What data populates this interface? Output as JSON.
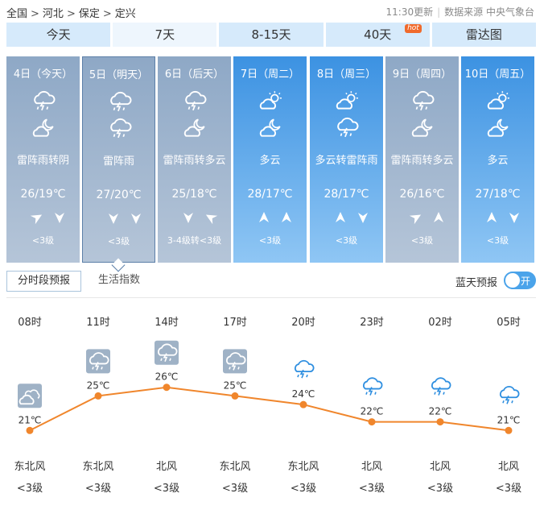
{
  "breadcrumb": {
    "items": [
      "全国",
      "河北",
      "保定",
      "定兴"
    ],
    "separator": ">"
  },
  "meta": {
    "updated": "11:30更新",
    "source": "数据来源 中央气象台"
  },
  "tabs": [
    {
      "label": "今天",
      "active": false
    },
    {
      "label": "7天",
      "active": true
    },
    {
      "label": "8-15天",
      "active": false
    },
    {
      "label": "40天",
      "active": false,
      "badge": "hot"
    },
    {
      "label": "雷达图",
      "active": false
    }
  ],
  "days": [
    {
      "date": "4日（今天）",
      "condition": "雷阵雨转阴",
      "temp": "26/19℃",
      "wind": "<3级",
      "icon1": "thunder-rain-icon",
      "icon2": "cloudy-night-icon",
      "dir1": "ne",
      "dir2": "s",
      "style": "past"
    },
    {
      "date": "5日（明天）",
      "condition": "雷阵雨",
      "temp": "27/20℃",
      "wind": "<3级",
      "icon1": "thunder-rain-icon",
      "icon2": "thunder-rain-icon",
      "dir1": "s",
      "dir2": "s",
      "style": "past",
      "selected": true
    },
    {
      "date": "6日（后天）",
      "condition": "雷阵雨转多云",
      "temp": "25/18℃",
      "wind": "3-4级转<3级",
      "icon1": "thunder-rain-icon",
      "icon2": "partly-cloudy-night-icon",
      "dir1": "s",
      "dir2": "nw",
      "style": "past"
    },
    {
      "date": "7日（周二）",
      "condition": "多云",
      "temp": "28/17℃",
      "wind": "<3级",
      "icon1": "partly-cloudy-day-icon",
      "icon2": "partly-cloudy-night-icon",
      "dir1": "n",
      "dir2": "n",
      "style": "fut"
    },
    {
      "date": "8日（周三）",
      "condition": "多云转雷阵雨",
      "temp": "28/17℃",
      "wind": "<3级",
      "icon1": "partly-cloudy-day-icon",
      "icon2": "thunder-rain-icon",
      "dir1": "n",
      "dir2": "s",
      "style": "fut"
    },
    {
      "date": "9日（周四）",
      "condition": "雷阵雨转多云",
      "temp": "26/16℃",
      "wind": "<3级",
      "icon1": "thunder-rain-icon",
      "icon2": "partly-cloudy-night-icon",
      "dir1": "ne",
      "dir2": "n",
      "style": "past"
    },
    {
      "date": "10日（周五）",
      "condition": "多云",
      "temp": "27/18℃",
      "wind": "<3级",
      "icon1": "partly-cloudy-day-icon",
      "icon2": "partly-cloudy-night-icon",
      "dir1": "n",
      "dir2": "s",
      "style": "fut"
    }
  ],
  "subtabs": {
    "active": "分时段预报",
    "other": "生活指数"
  },
  "bluesky": {
    "label": "蓝天预报",
    "toggle_label": "开"
  },
  "hourly": {
    "times": [
      "08时",
      "11时",
      "14时",
      "17时",
      "20时",
      "23时",
      "02时",
      "05时"
    ],
    "temps_label": [
      "21℃",
      "25℃",
      "26℃",
      "25℃",
      "24℃",
      "22℃",
      "22℃",
      "21℃"
    ],
    "winds": [
      "东北风",
      "东北风",
      "北风",
      "东北风",
      "东北风",
      "北风",
      "北风",
      "北风"
    ],
    "levels": [
      "<3级",
      "<3级",
      "<3级",
      "<3级",
      "<3级",
      "<3级",
      "<3级",
      "<3级"
    ],
    "icons": [
      "cloudy-icon",
      "thunder-rain-icon",
      "thunder-rain-icon",
      "thunder-rain-icon",
      "thunder-rain-night-icon",
      "thunder-rain-night-icon",
      "thunder-rain-night-icon",
      "thunder-rain-night-icon"
    ],
    "icon_boxed": [
      true,
      true,
      true,
      true,
      false,
      false,
      false,
      false
    ]
  },
  "chart_data": {
    "type": "line",
    "x": [
      "08时",
      "11时",
      "14时",
      "17时",
      "20时",
      "23时",
      "02时",
      "05时"
    ],
    "series": [
      {
        "values": [
          21,
          25,
          26,
          25,
          24,
          22,
          22,
          21
        ]
      }
    ],
    "ylim": [
      20,
      27
    ],
    "color": "#f0862c"
  },
  "colors": {
    "tab_bg": "#d6eafb",
    "past_card": "#8ea8c6",
    "future_card": "#3c92e2",
    "line": "#f0862c",
    "toggle": "#4aa3ea"
  }
}
